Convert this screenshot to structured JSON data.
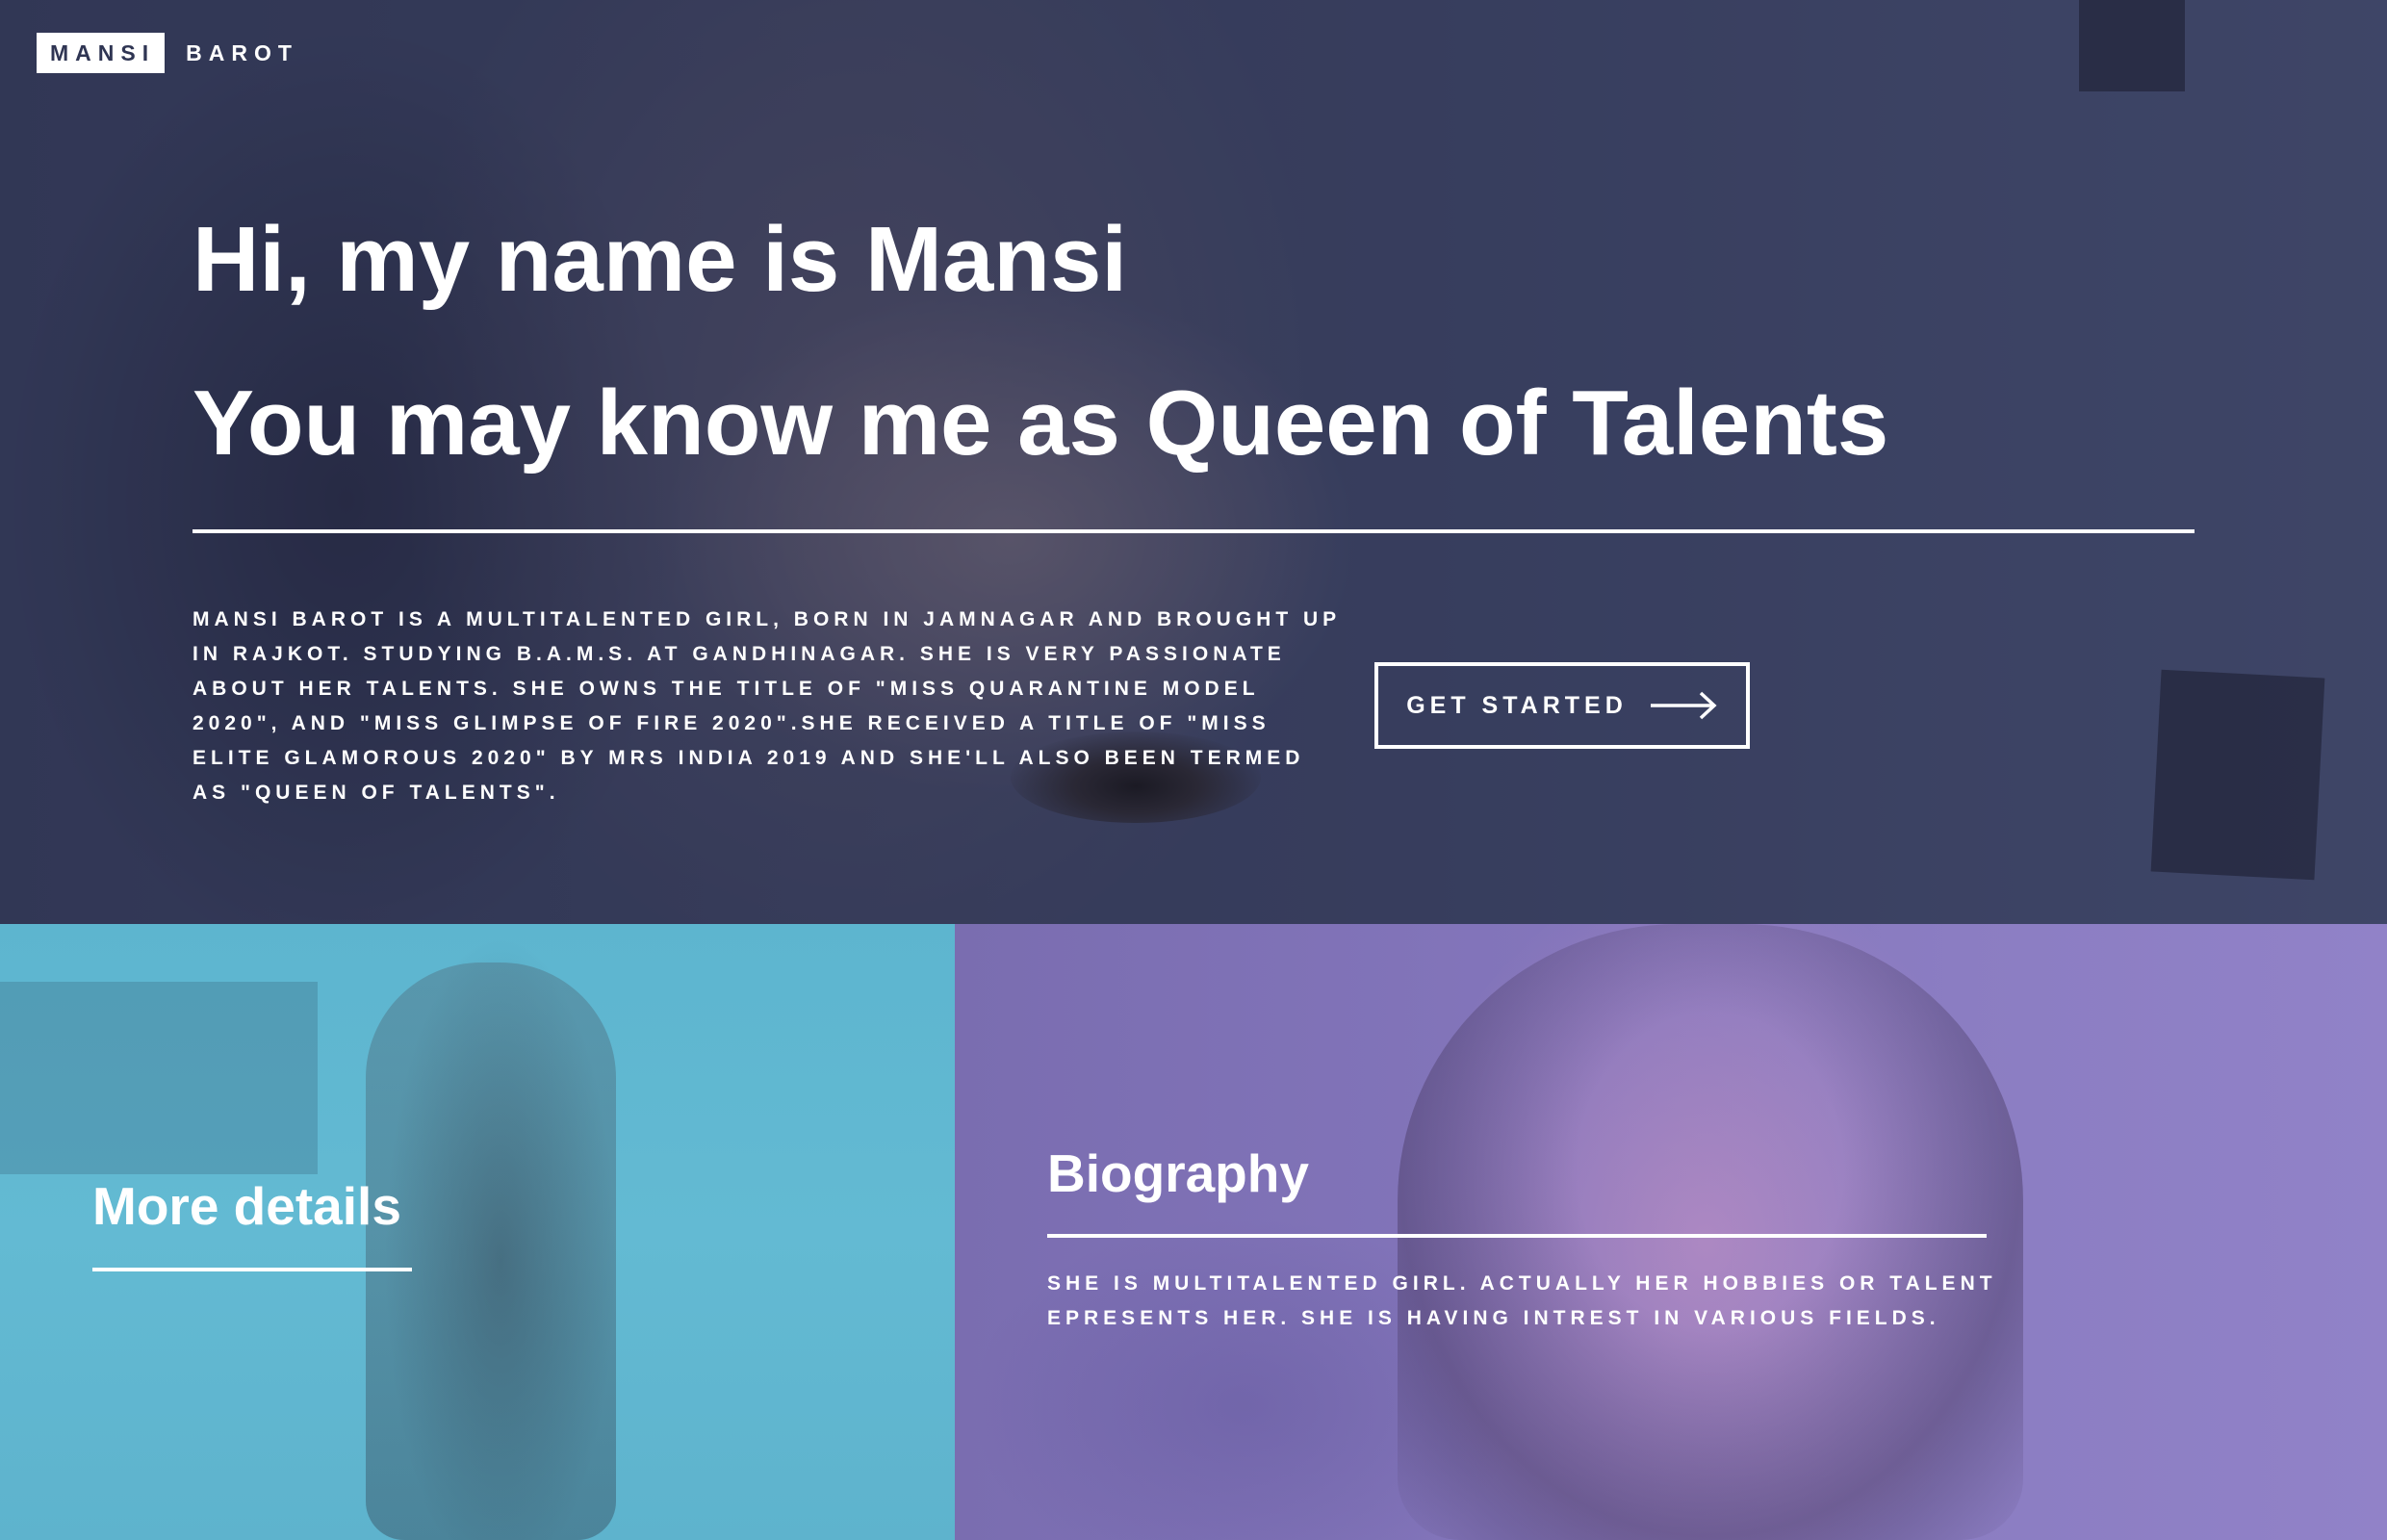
{
  "header": {
    "logo_first": "MANSI",
    "logo_last": "BAROT"
  },
  "hero": {
    "heading_line1": "Hi, my name is Mansi",
    "heading_line2": "You may know me as Queen of Talents",
    "description": "Mansi Barot is a multitalented girl, born in Jamnagar and brought up in Rajkot. Studying B.A.M.S. at Gandhinagar. She is very passionate about her talents. She owns the title of \"Miss Quarantine Model 2020\", and \"Miss glimpse of fire 2020\".She received a title of \"Miss Elite Glamorous 2020\" by Mrs India 2019 and she'll also been termed as \"Queen of Talents\".",
    "cta_label": "GET STARTED",
    "cta_icon": "arrow-right-icon"
  },
  "panels": {
    "more_details": {
      "title": "More details"
    },
    "biography": {
      "title": "Biography",
      "text": "She is multitalented girl. Actually her hobbies or talent epresents her. She is having intrest in various fields."
    }
  },
  "colors": {
    "hero_overlay": "#2e3450",
    "panel_left": "#5eb5cf",
    "panel_right": "#8477bd",
    "text": "#ffffff"
  }
}
